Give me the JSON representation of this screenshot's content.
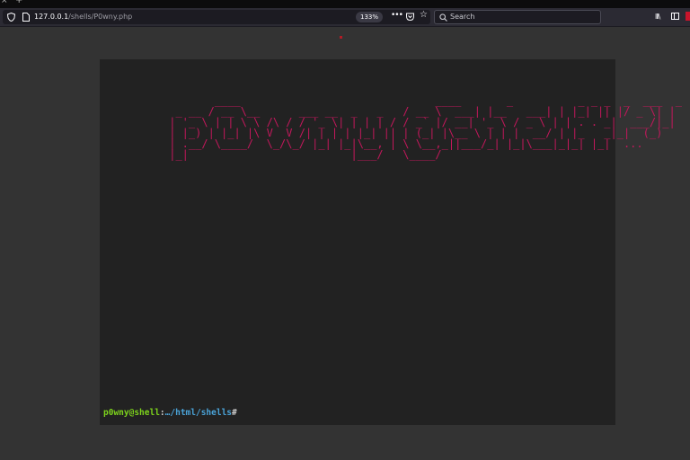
{
  "browser": {
    "url_host": "127.0.0.1",
    "url_path": "/shells/P0wny.php",
    "zoom": "133%",
    "search_placeholder": "Search",
    "overflow_menu": "•••",
    "bookmark_star": "☆",
    "library": "lll\\"
  },
  "terminal": {
    "ascii_banner": "        ____                              ____       _          _ _ _  _  ___  _\n  _ __ / __ \\__      ___ __  _   _   / __ \\  ___| |__   ___| | |_| || |/ _ \\| |\n | '_ \\ | | \\ \\ /\\ / / '_ \\| | | | / / _` |/ __| '_ \\ / _ \\ | | . . _|  ___/|_|\n | |_) | |_| |\\ V  V /| | | | |_| || | (_| |\\__ \\ | | |  __/ | |_   _|_|  (_) \n | .__/ \\____/  \\_/\\_/ |_| |_|\\__, | \\ \\__,_||___/_| |_|\\___|_|_| |_|  ...     \n |_|                         |___/   \\____/                                   ",
    "prompt_user": "p0wny@shell",
    "prompt_colon": ":",
    "prompt_path": "…/html/shells",
    "prompt_symbol": "#"
  },
  "colors": {
    "prompt_user": "#7dd31c",
    "prompt_path": "#4aa3d8",
    "banner": "#c2185b",
    "terminal_bg": "#222222"
  }
}
